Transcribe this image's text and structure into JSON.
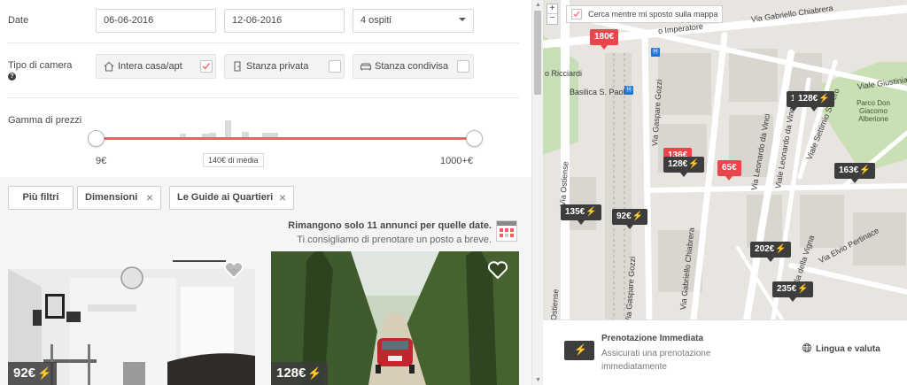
{
  "filters": {
    "date_label": "Date",
    "checkin": "06-06-2016",
    "checkout": "12-06-2016",
    "guests": "4 ospiti",
    "room_type_label": "Tipo di camera",
    "room_types": [
      {
        "label": "Intera casa/apt",
        "checked": true
      },
      {
        "label": "Stanza privata",
        "checked": false
      },
      {
        "label": "Stanza condivisa",
        "checked": false
      }
    ],
    "price_range_label": "Gamma di prezzi",
    "price_min": "9€",
    "price_max": "1000+€",
    "price_avg": "140€ di media"
  },
  "chips": {
    "more_filters": "Più filtri",
    "size": "Dimensioni",
    "guides": "Le Guide ai Quartieri"
  },
  "notice": {
    "line1": "Rimangono solo 11 annunci per quelle date.",
    "line2": "Ti consigliamo di prenotare un posto a breve."
  },
  "listings": [
    {
      "price": "92€",
      "instant": true
    },
    {
      "price": "128€",
      "instant": true
    }
  ],
  "map": {
    "search_as_move": "Cerca mentre mi sposto sulla mappa",
    "zoom_in": "+",
    "zoom_out": "−",
    "prices": [
      {
        "label": "180€",
        "style": "red",
        "instant": false
      },
      {
        "label": "128€",
        "style": "dark",
        "instant": true
      },
      {
        "label": "1",
        "style": "dark",
        "instant": false
      },
      {
        "label": "136€",
        "style": "red",
        "instant": false
      },
      {
        "label": "128€",
        "style": "dark",
        "instant": true
      },
      {
        "label": "65€",
        "style": "red",
        "instant": false
      },
      {
        "label": "163€",
        "style": "dark",
        "instant": true
      },
      {
        "label": "135€",
        "style": "dark",
        "instant": true
      },
      {
        "label": "92€",
        "style": "dark",
        "instant": true
      },
      {
        "label": "202€",
        "style": "dark",
        "instant": true
      },
      {
        "label": "235€",
        "style": "dark",
        "instant": true
      }
    ],
    "streets": {
      "imperatore": "o Imperatore",
      "chiabrera_top": "Via Gabriello Chiabrera",
      "ricciardi": "o Ricciardi",
      "basilica": "Basilica S. Paolo",
      "gozzi": "Via Gaspare Gozzi",
      "ostiense": "Via Ostiense",
      "ostiense2": "Ostiense",
      "davinci": "Viale Leonardo da Vinci",
      "davinci2": "Via Leonardo da Vinci",
      "severo": "Viale Settimio Severo",
      "giustiniano": "Viale Giustinia",
      "parco": "Parco Don Giacomo Alberione",
      "pertinace": "Via Elvio Pertinace",
      "chiabrera_bottom": "Via Gabriello Chiabrera",
      "gozzi2": "Via Gaspare Gozzi",
      "vigna": "Via della Vigna"
    }
  },
  "instant_booking": {
    "title": "Prenotazione Immediata",
    "desc": "Assicurati una prenotazione immediatamente"
  },
  "language": {
    "label": "Lingua e valuta"
  },
  "colors": {
    "accent": "#ff5a5f",
    "map_pin_dark": "#3d3d3d",
    "map_pin_red": "#e8464c",
    "instant_bolt": "#ffb400"
  }
}
